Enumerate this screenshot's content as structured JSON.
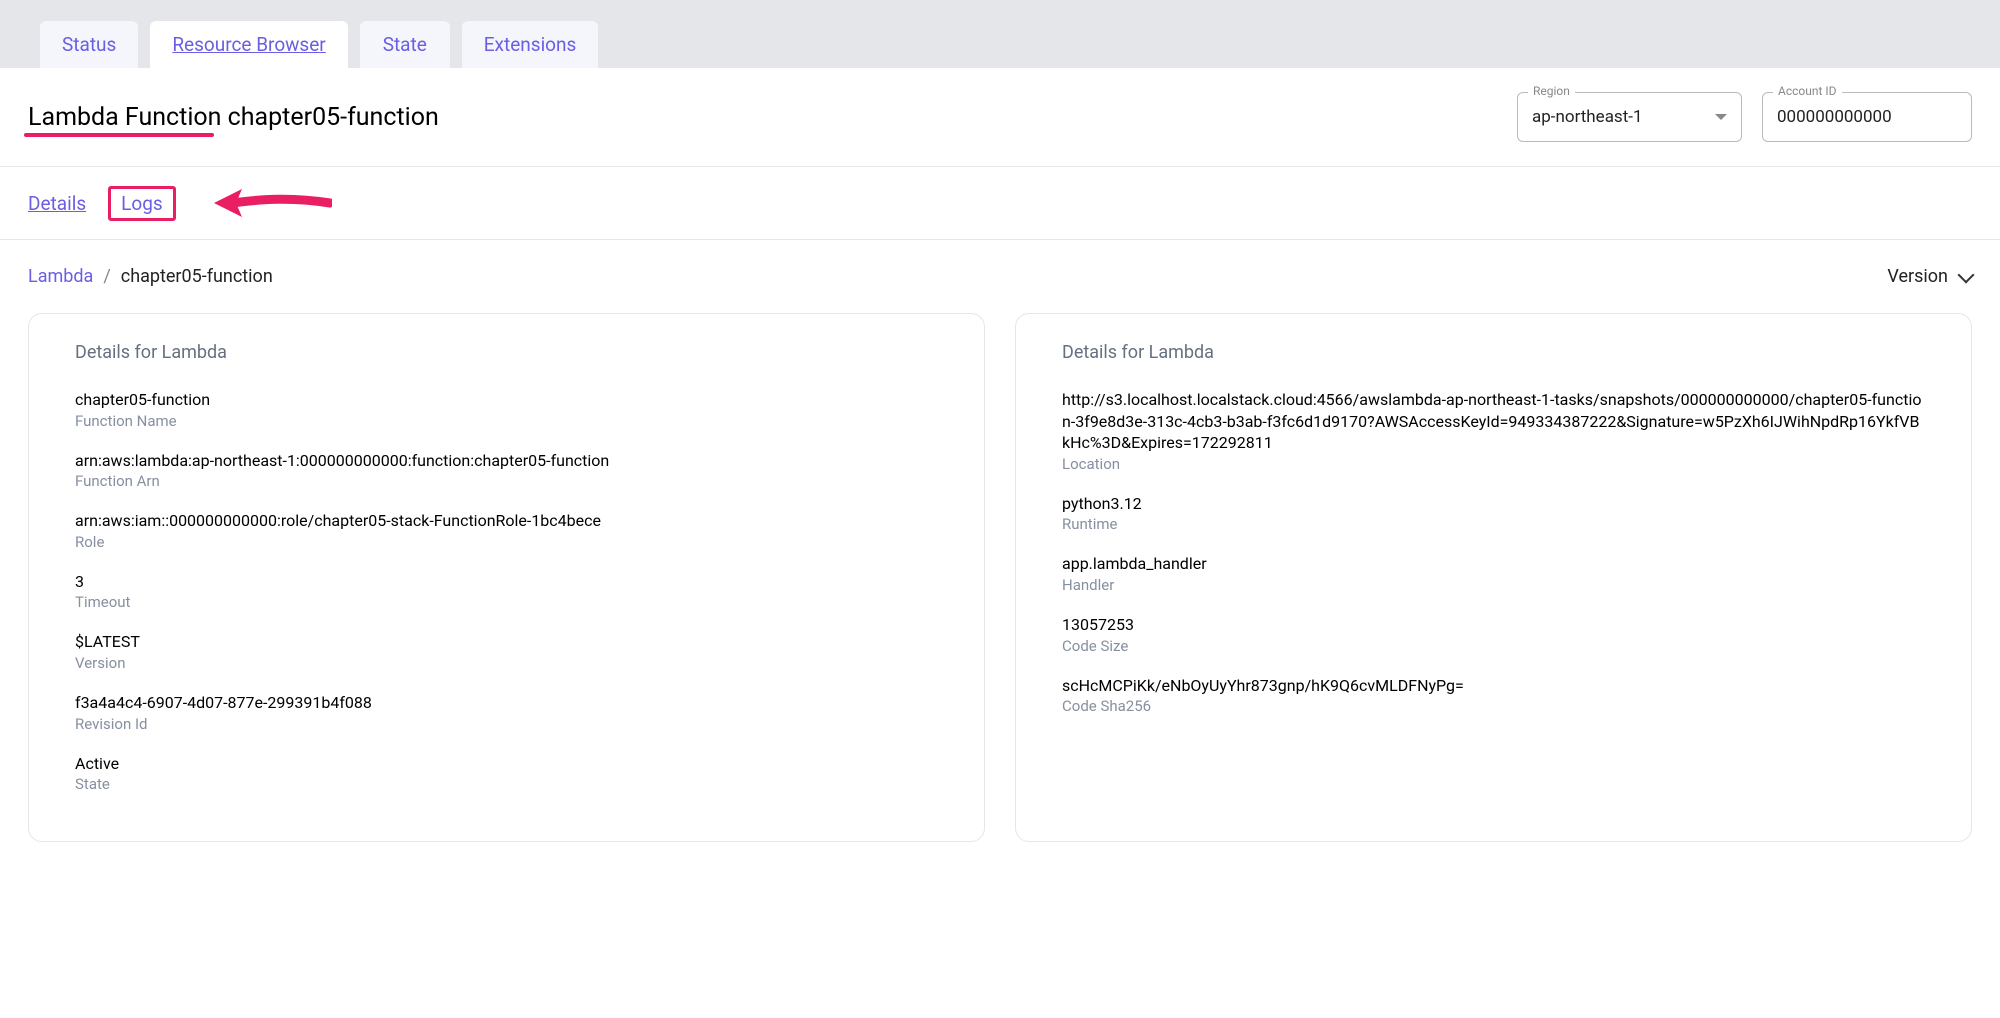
{
  "topTabs": {
    "status": "Status",
    "resourceBrowser": "Resource Browser",
    "state": "State",
    "extensions": "Extensions"
  },
  "header": {
    "title": "Lambda Function chapter05-function",
    "region": {
      "legend": "Region",
      "value": "ap-northeast-1"
    },
    "accountId": {
      "legend": "Account ID",
      "value": "000000000000"
    }
  },
  "subTabs": {
    "details": "Details",
    "logs": "Logs"
  },
  "breadcrumb": {
    "root": "Lambda",
    "sep": "/",
    "current": "chapter05-function"
  },
  "versionSelect": {
    "label": "Version"
  },
  "panels": {
    "left": {
      "title": "Details for Lambda",
      "functionName": {
        "value": "chapter05-function",
        "label": "Function Name"
      },
      "functionArn": {
        "value": "arn:aws:lambda:ap-northeast-1:000000000000:function:chapter05-function",
        "label": "Function Arn"
      },
      "role": {
        "value": "arn:aws:iam::000000000000:role/chapter05-stack-FunctionRole-1bc4bece",
        "label": "Role"
      },
      "timeout": {
        "value": "3",
        "label": "Timeout"
      },
      "version": {
        "value": "$LATEST",
        "label": "Version"
      },
      "revisionId": {
        "value": "f3a4a4c4-6907-4d07-877e-299391b4f088",
        "label": "Revision Id"
      },
      "state": {
        "value": "Active",
        "label": "State"
      }
    },
    "right": {
      "title": "Details for Lambda",
      "location": {
        "value": "http://s3.localhost.localstack.cloud:4566/awslambda-ap-northeast-1-tasks/snapshots/000000000000/chapter05-function-3f9e8d3e-313c-4cb3-b3ab-f3fc6d1d9170?AWSAccessKeyId=949334387222&Signature=w5PzXh6IJWihNpdRp16YkfVBkHc%3D&Expires=172292811",
        "label": "Location"
      },
      "runtime": {
        "value": "python3.12",
        "label": "Runtime"
      },
      "handler": {
        "value": "app.lambda_handler",
        "label": "Handler"
      },
      "codeSize": {
        "value": "13057253",
        "label": "Code Size"
      },
      "codeSha256": {
        "value": "scHcMCPiKk/eNbOyUyYhr873gnp/hK9Q6cvMLDFNyPg=",
        "label": "Code Sha256"
      }
    }
  }
}
